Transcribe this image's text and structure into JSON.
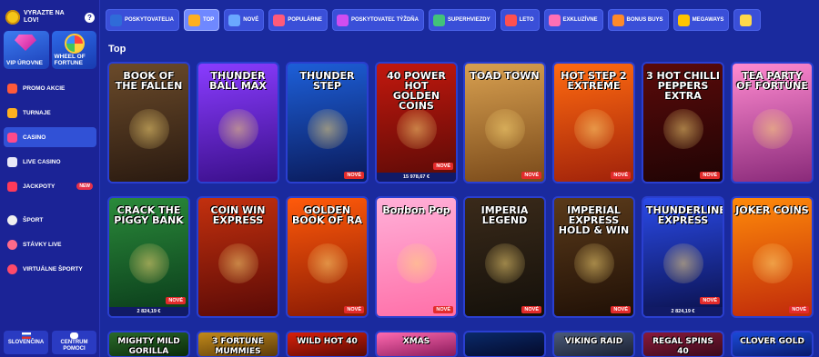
{
  "sidebar": {
    "hunt_text": "VYRAZTE NA LOV!",
    "help": "?",
    "tiles": [
      {
        "label": "VIP ÚROVNE"
      },
      {
        "label": "WHEEL OF FORTUNE"
      }
    ],
    "items": [
      {
        "label": "PROMO AKCIE",
        "icon": "gift-icon"
      },
      {
        "label": "TURNAJE",
        "icon": "trophy-icon"
      },
      {
        "label": "CASINO",
        "icon": "slot-icon",
        "active": true
      },
      {
        "label": "LIVE CASINO",
        "icon": "live-icon"
      },
      {
        "label": "JACKPOTY",
        "icon": "jackpot-icon",
        "badge": "NEW"
      },
      {
        "label": "ŠPORT",
        "icon": "ball-icon"
      },
      {
        "label": "STÁVKY LIVE",
        "icon": "live-bet-icon"
      },
      {
        "label": "VIRTUÁLNE ŠPORTY",
        "icon": "virtual-icon"
      }
    ],
    "language": "SLOVENČINA",
    "help_center": "CENTRUM POMOCI"
  },
  "categories": [
    {
      "label": "POSKYTOVATELIA",
      "color": "#2f6bd8"
    },
    {
      "label": "TOP",
      "color": "#ffb01f",
      "active": true
    },
    {
      "label": "NOVÉ",
      "color": "#6aa8ff"
    },
    {
      "label": "POPULÁRNE",
      "color": "#ff5a7a"
    },
    {
      "label": "POSKYTOVATEĽ TÝŽDŇA",
      "color": "#d04df0"
    },
    {
      "label": "SUPERHVIEZDY",
      "color": "#42c27a"
    },
    {
      "label": "LETO",
      "color": "#ff5050"
    },
    {
      "label": "EXKLUZÍVNE",
      "color": "#ff6fb5"
    },
    {
      "label": "BONUS BUYS",
      "color": "#ff8a2a"
    },
    {
      "label": "MEGAWAYS",
      "color": "#ffc400"
    },
    {
      "label": "",
      "color": "#ffd84a"
    }
  ],
  "section_title": "Top",
  "games": [
    {
      "title": "BOOK OF THE FALLEN",
      "badge": "",
      "jackpot": "",
      "colors": [
        "#6a4a2a",
        "#2a1a10"
      ]
    },
    {
      "title": "THUNDER BALL MAX",
      "badge": "",
      "jackpot": "",
      "colors": [
        "#8a3cff",
        "#3a0f8a"
      ]
    },
    {
      "title": "THUNDER STEP",
      "badge": "NOVÉ",
      "jackpot": "",
      "colors": [
        "#1d5fd8",
        "#0a1a5a"
      ]
    },
    {
      "title": "40 POWER HOT GOLDEN COINS",
      "badge": "NOVÉ",
      "jackpot": "15 978,67 €",
      "colors": [
        "#c2180e",
        "#5a0a06"
      ]
    },
    {
      "title": "TOAD TOWN",
      "badge": "NOVÉ",
      "jackpot": "",
      "colors": [
        "#d8a050",
        "#7a4a1a"
      ]
    },
    {
      "title": "HOT STEP 2 EXTREME",
      "badge": "NOVÉ",
      "jackpot": "",
      "colors": [
        "#ff6a10",
        "#a0220a"
      ]
    },
    {
      "title": "3 HOT CHILLI PEPPERS EXTRA",
      "badge": "NOVÉ",
      "jackpot": "",
      "colors": [
        "#5a0a0a",
        "#200404"
      ]
    },
    {
      "title": "TEA PARTY OF FORTUNE",
      "badge": "",
      "jackpot": "",
      "colors": [
        "#ff8ad0",
        "#8a2a7a"
      ]
    },
    {
      "title": "CRACK THE PIGGY BANK",
      "badge": "NOVÉ",
      "jackpot": "2 824,19 €",
      "colors": [
        "#2a8a3a",
        "#0a3a1a"
      ]
    },
    {
      "title": "COIN WIN EXPRESS",
      "badge": "",
      "jackpot": "",
      "colors": [
        "#c2300e",
        "#5a0a06"
      ]
    },
    {
      "title": "GOLDEN BOOK OF RA",
      "badge": "NOVÉ",
      "jackpot": "",
      "colors": [
        "#ff5a0a",
        "#8a1a04"
      ]
    },
    {
      "title": "Bonbon Pop",
      "badge": "NOVÉ",
      "jackpot": "",
      "colors": [
        "#ffb0d8",
        "#ff6fa8"
      ]
    },
    {
      "title": "IMPERIA LEGEND",
      "badge": "NOVÉ",
      "jackpot": "",
      "colors": [
        "#3a2a1a",
        "#14100a"
      ]
    },
    {
      "title": "IMPERIAL EXPRESS HOLD & WIN",
      "badge": "NOVÉ",
      "jackpot": "",
      "colors": [
        "#5a3a1a",
        "#201006"
      ]
    },
    {
      "title": "THUNDERLINE EXPRESS",
      "badge": "NOVÉ",
      "jackpot": "2 824,19 €",
      "colors": [
        "#2a4ae8",
        "#0a104a"
      ]
    },
    {
      "title": "JOKER COINS",
      "badge": "NOVÉ",
      "jackpot": "",
      "colors": [
        "#ff8a0a",
        "#c02a0a"
      ]
    },
    {
      "title": "MIGHTY MILD GORILLA",
      "badge": "",
      "jackpot": "",
      "colors": [
        "#2a6a2a",
        "#0a2a0a"
      ]
    },
    {
      "title": "3 FORTUNE MUMMIES",
      "badge": "",
      "jackpot": "",
      "colors": [
        "#c28a1a",
        "#5a3a0a"
      ]
    },
    {
      "title": "WILD HOT 40",
      "badge": "",
      "jackpot": "",
      "colors": [
        "#d8200a",
        "#5a0a04"
      ]
    },
    {
      "title": "XMAS",
      "badge": "",
      "jackpot": "",
      "colors": [
        "#ff6ab0",
        "#8a1a5a"
      ]
    },
    {
      "title": "",
      "badge": "",
      "jackpot": "",
      "colors": [
        "#0a2a6a",
        "#040a2a"
      ]
    },
    {
      "title": "VIKING RAID",
      "badge": "",
      "jackpot": "",
      "colors": [
        "#4a5a7a",
        "#1a2030"
      ]
    },
    {
      "title": "REGAL SPINS 40",
      "badge": "",
      "jackpot": "",
      "colors": [
        "#8a1a3a",
        "#3a0a1a"
      ]
    },
    {
      "title": "CLOVER GOLD",
      "badge": "",
      "jackpot": "",
      "colors": [
        "#1a4ad8",
        "#0a1a6a"
      ]
    }
  ]
}
